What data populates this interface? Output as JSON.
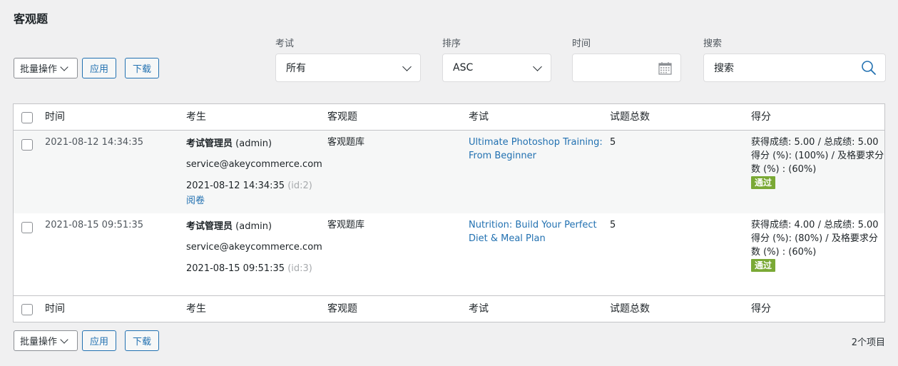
{
  "page": {
    "title": "客观题"
  },
  "toolbar": {
    "bulk_action": "批量操作",
    "apply": "应用",
    "download": "下载"
  },
  "filters": {
    "exam": {
      "label": "考试",
      "value": "所有"
    },
    "order": {
      "label": "排序",
      "value": "ASC"
    },
    "time": {
      "label": "时间",
      "value": ""
    },
    "search": {
      "label": "搜索",
      "placeholder": "搜索"
    }
  },
  "table": {
    "columns": [
      "时间",
      "考生",
      "客观题",
      "考试",
      "试题总数",
      "得分"
    ],
    "rows": [
      {
        "time": "2021-08-12 14:34:35",
        "name": "考试管理员",
        "login": "(admin)",
        "email": "service@akeycommerce.com",
        "date": "2021-08-12 14:34:35",
        "id": "(id:2)",
        "review": "阅卷",
        "bank": "客观题库",
        "exam_line1": "Ultimate Photoshop Training:",
        "exam_line2": "From Beginner",
        "total": "5",
        "score_line1": "获得成绩: 5.00 / 总成绩: 5.00",
        "score_line2": "得分 (%): (100%) / 及格要求分",
        "score_line3": "数 (%) : (60%)",
        "status": "通过"
      },
      {
        "time": "2021-08-15 09:51:35",
        "name": "考试管理员",
        "login": "(admin)",
        "email": "service@akeycommerce.com",
        "date": "2021-08-15 09:51:35",
        "id": "(id:3)",
        "bank": "客观题库",
        "exam_line1": "Nutrition: Build Your Perfect",
        "exam_line2": "Diet & Meal Plan",
        "total": "5",
        "score_line1": "获得成绩: 4.00 / 总成绩: 5.00",
        "score_line2": "得分 (%): (80%) / 及格要求分",
        "score_line3": "数 (%) : (60%)",
        "status": "通过"
      }
    ]
  },
  "footer": {
    "count": "2个项目"
  },
  "colors": {
    "accent": "#2271b1",
    "pass": "#7aa935",
    "background": "#f0f0f1"
  },
  "icons": {
    "calendar": "calendar-icon",
    "search": "search-icon",
    "chevron": "chevron-down-icon"
  }
}
